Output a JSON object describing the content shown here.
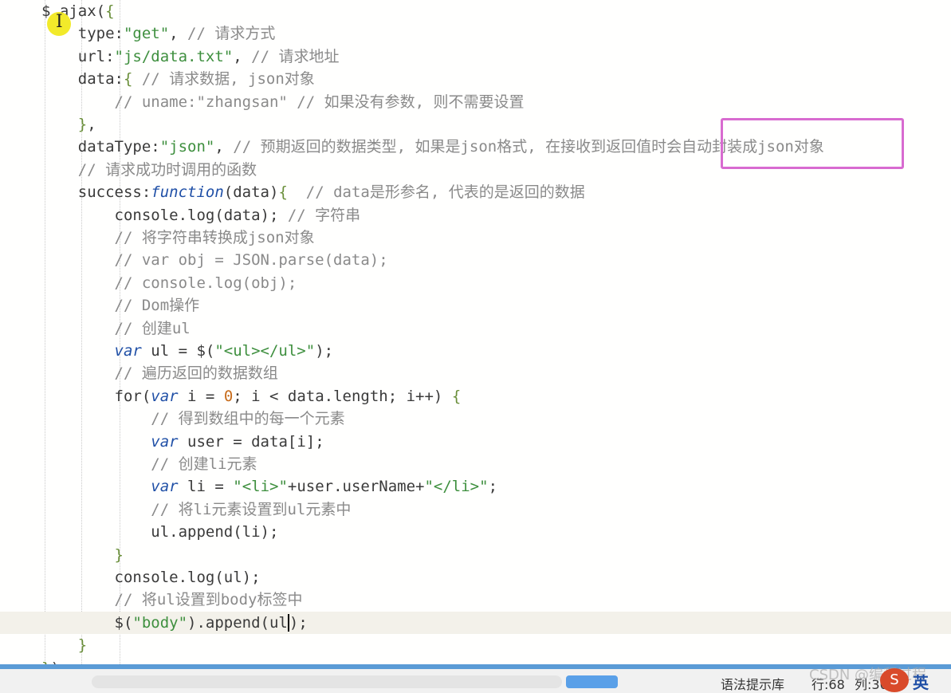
{
  "code_lines": [
    {
      "i": 0,
      "parts": [
        [
          "pl",
          "$."
        ],
        [
          "pl",
          "ajax("
        ],
        [
          "brace",
          "{"
        ]
      ]
    },
    {
      "i": 1,
      "parts": [
        [
          "pl",
          "    type:"
        ],
        [
          "str",
          "\"get\""
        ],
        [
          "pl",
          ", "
        ],
        [
          "com",
          "// 请求方式"
        ]
      ]
    },
    {
      "i": 2,
      "parts": [
        [
          "pl",
          "    url:"
        ],
        [
          "str",
          "\"js/data.txt\""
        ],
        [
          "pl",
          ", "
        ],
        [
          "com",
          "// 请求地址"
        ]
      ]
    },
    {
      "i": 3,
      "parts": [
        [
          "pl",
          "    data:"
        ],
        [
          "brace",
          "{"
        ],
        [
          "pl",
          " "
        ],
        [
          "com",
          "// 请求数据, json对象"
        ]
      ]
    },
    {
      "i": 4,
      "parts": [
        [
          "com",
          "        // uname:\"zhangsan\" // 如果没有参数, 则不需要设置"
        ]
      ]
    },
    {
      "i": 5,
      "parts": [
        [
          "pl",
          "    "
        ],
        [
          "brace",
          "}"
        ],
        [
          "pl",
          ","
        ]
      ]
    },
    {
      "i": 6,
      "parts": [
        [
          "pl",
          "    dataType:"
        ],
        [
          "str",
          "\"json\""
        ],
        [
          "pl",
          ", "
        ],
        [
          "com",
          "// 预期返回的数据类型, 如果是json格式, 在接收到返回值时会自动封装成json对象"
        ]
      ]
    },
    {
      "i": 7,
      "parts": [
        [
          "com",
          "    // 请求成功时调用的函数"
        ]
      ]
    },
    {
      "i": 8,
      "parts": [
        [
          "pl",
          "    success:"
        ],
        [
          "fn",
          "function"
        ],
        [
          "pl",
          "(data)"
        ],
        [
          "brace",
          "{"
        ],
        [
          "pl",
          "  "
        ],
        [
          "com",
          "// data是形参名, 代表的是返回的数据"
        ]
      ]
    },
    {
      "i": 9,
      "parts": [
        [
          "pl",
          "        console.log(data); "
        ],
        [
          "com",
          "// 字符串"
        ]
      ]
    },
    {
      "i": 10,
      "parts": [
        [
          "com",
          "        // 将字符串转换成json对象"
        ]
      ]
    },
    {
      "i": 11,
      "parts": [
        [
          "com",
          "        // var obj = JSON.parse(data);"
        ]
      ]
    },
    {
      "i": 12,
      "parts": [
        [
          "com",
          "        // console.log(obj);"
        ]
      ]
    },
    {
      "i": 13,
      "parts": [
        [
          "com",
          "        // Dom操作"
        ]
      ]
    },
    {
      "i": 14,
      "parts": [
        [
          "com",
          "        // 创建ul"
        ]
      ]
    },
    {
      "i": 15,
      "parts": [
        [
          "pl",
          "        "
        ],
        [
          "fn",
          "var"
        ],
        [
          "pl",
          " ul = $("
        ],
        [
          "str",
          "\"<ul></ul>\""
        ],
        [
          "pl",
          ");"
        ]
      ]
    },
    {
      "i": 16,
      "parts": [
        [
          "com",
          "        // 遍历返回的数据数组"
        ]
      ]
    },
    {
      "i": 17,
      "parts": [
        [
          "pl",
          "        for("
        ],
        [
          "fn",
          "var"
        ],
        [
          "pl",
          " i = "
        ],
        [
          "num",
          "0"
        ],
        [
          "pl",
          "; i < data.length; i++) "
        ],
        [
          "brace",
          "{"
        ]
      ]
    },
    {
      "i": 18,
      "parts": [
        [
          "com",
          "            // 得到数组中的每一个元素"
        ]
      ]
    },
    {
      "i": 19,
      "parts": [
        [
          "pl",
          "            "
        ],
        [
          "fn",
          "var"
        ],
        [
          "pl",
          " user = data[i];"
        ]
      ]
    },
    {
      "i": 20,
      "parts": [
        [
          "com",
          "            // 创建li元素"
        ]
      ]
    },
    {
      "i": 21,
      "parts": [
        [
          "pl",
          "            "
        ],
        [
          "fn",
          "var"
        ],
        [
          "pl",
          " li = "
        ],
        [
          "str",
          "\"<li>\""
        ],
        [
          "pl",
          "+user.userName+"
        ],
        [
          "str",
          "\"</li>\""
        ],
        [
          "pl",
          ";"
        ]
      ]
    },
    {
      "i": 22,
      "parts": [
        [
          "com",
          "            // 将li元素设置到ul元素中"
        ]
      ]
    },
    {
      "i": 23,
      "parts": [
        [
          "pl",
          "            ul.append(li);"
        ]
      ]
    },
    {
      "i": 24,
      "parts": [
        [
          "pl",
          "        "
        ],
        [
          "brace",
          "}"
        ]
      ]
    },
    {
      "i": 25,
      "parts": [
        [
          "pl",
          "        console.log(ul);"
        ]
      ]
    },
    {
      "i": 26,
      "parts": [
        [
          "com",
          "        // 将ul设置到body标签中"
        ]
      ]
    },
    {
      "i": 27,
      "parts": [
        [
          "pl",
          "        $("
        ],
        [
          "str",
          "\"body\""
        ],
        [
          "pl",
          ").append(ul"
        ],
        [
          "cursor",
          ""
        ],
        [
          "pl",
          ");"
        ]
      ]
    },
    {
      "i": 28,
      "parts": [
        [
          "pl",
          "    "
        ],
        [
          "brace",
          "}"
        ]
      ]
    },
    {
      "i": 29,
      "parts": [
        [
          "brace",
          "}"
        ],
        [
          "pl",
          ");"
        ]
      ]
    }
  ],
  "current_line_index": 27,
  "status": {
    "syntax_hint": "语法提示库",
    "row": "行:68",
    "col": "列:30"
  },
  "watermark": "CSDN @编程过程",
  "ime": {
    "icon": "S",
    "lang": "英"
  },
  "colors": {
    "highlight_box": "#d86bd0",
    "pointer_dot": "#f2ea2a",
    "scroll_accent": "#5aa0e8"
  }
}
